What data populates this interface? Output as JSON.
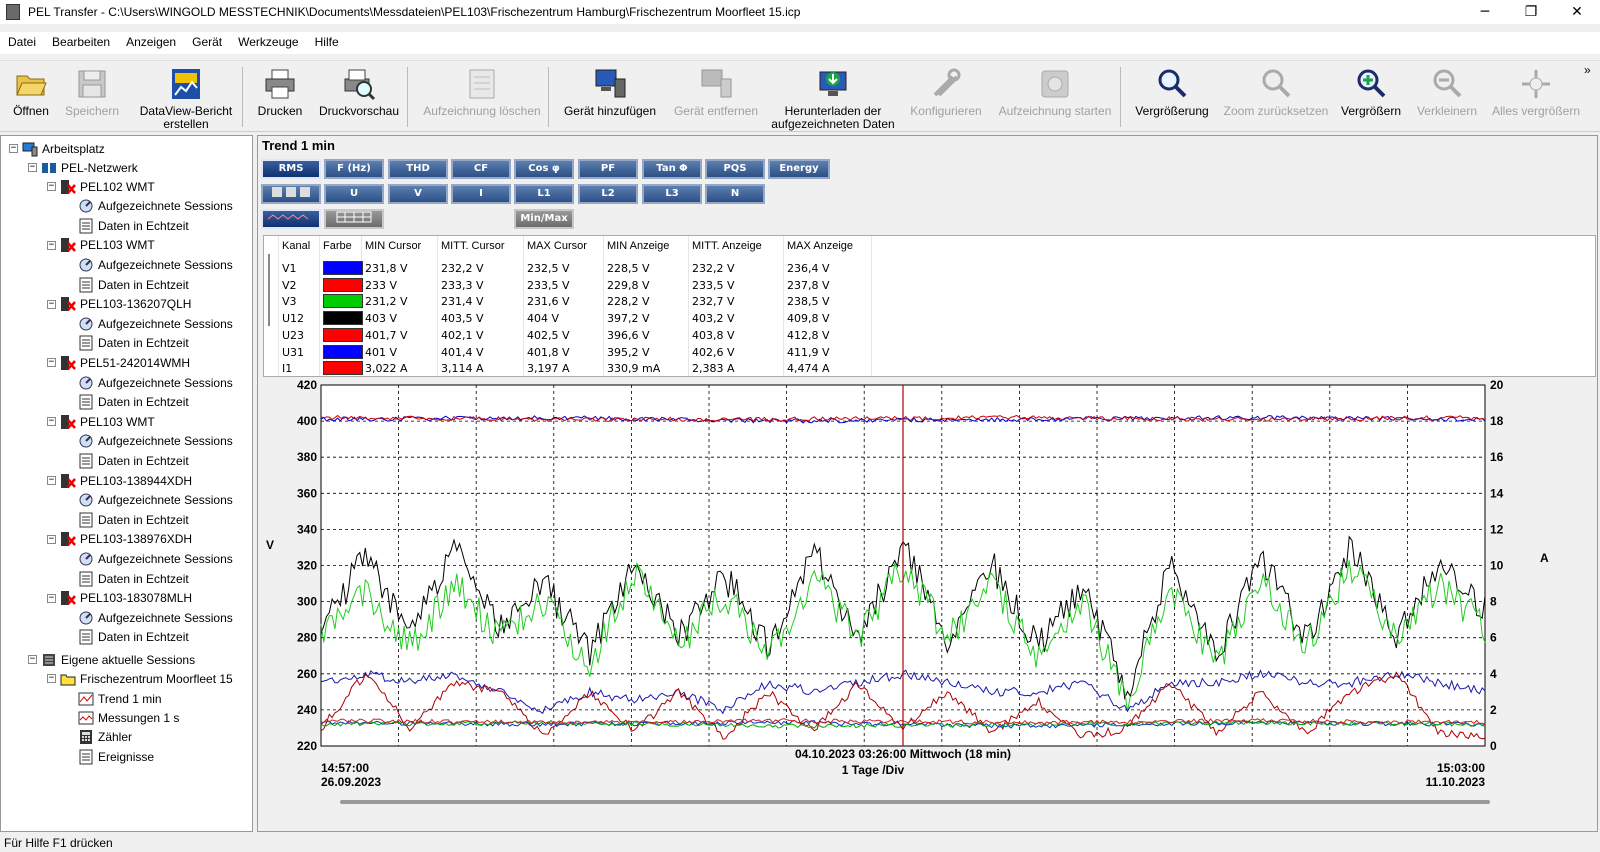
{
  "window": {
    "title": "PEL Transfer - C:\\Users\\WINGOLD MESSTECHNIK\\Documents\\Messdateien\\PEL103\\Frischezentrum Hamburg\\Frischezentrum Moorfleet 15.icp",
    "minimize": "─",
    "maximize": "❐",
    "close": "✕"
  },
  "menu": [
    "Datei",
    "Bearbeiten",
    "Anzeigen",
    "Gerät",
    "Werkzeuge",
    "Hilfe"
  ],
  "toolbar": {
    "open": "Öffnen",
    "save": "Speichern",
    "dataview_l1": "DataView-Bericht",
    "dataview_l2": "erstellen",
    "print": "Drucken",
    "preview": "Druckvorschau",
    "delete_rec": "Aufzeichnung löschen",
    "add_device": "Gerät hinzufügen",
    "remove_device": "Gerät entfernen",
    "download_l1": "Herunterladen der",
    "download_l2": "aufgezeichneten Daten",
    "configure": "Konfigurieren",
    "start_rec": "Aufzeichnung starten",
    "zoom": "Vergrößerung",
    "zoom_reset": "Zoom zurücksetzen",
    "zoom_in": "Vergrößern",
    "zoom_out": "Verkleinern",
    "zoom_all": "Alles vergrößern",
    "overflow": "»"
  },
  "tree": {
    "root": "Arbeitsplatz",
    "network": "PEL-Netzwerk",
    "devices": [
      {
        "name": "PEL102 WMT",
        "sessions": "Aufgezeichnete Sessions",
        "realtime": "Daten in Echtzeit"
      },
      {
        "name": "PEL103 WMT",
        "sessions": "Aufgezeichnete Sessions",
        "realtime": "Daten in Echtzeit"
      },
      {
        "name": "PEL103-136207QLH",
        "sessions": "Aufgezeichnete Sessions",
        "realtime": "Daten in Echtzeit"
      },
      {
        "name": "PEL51-242014WMH",
        "sessions": "Aufgezeichnete Sessions",
        "realtime": "Daten in Echtzeit"
      },
      {
        "name": "PEL103 WMT",
        "sessions": "Aufgezeichnete Sessions",
        "realtime": "Daten in Echtzeit"
      },
      {
        "name": "PEL103-138944XDH",
        "sessions": "Aufgezeichnete Sessions",
        "realtime": "Daten in Echtzeit"
      },
      {
        "name": "PEL103-138976XDH",
        "sessions": "Aufgezeichnete Sessions",
        "realtime": "Daten in Echtzeit"
      },
      {
        "name": "PEL103-183078MLH",
        "sessions": "Aufgezeichnete Sessions",
        "realtime": "Daten in Echtzeit"
      }
    ],
    "own_sessions": "Eigene aktuelle Sessions",
    "session": "Frischezentrum Moorfleet 15",
    "children": [
      "Trend 1 min",
      "Messungen 1 s",
      "Zähler",
      "Ereignisse"
    ]
  },
  "panel": {
    "title": "Trend 1 min",
    "row1": [
      "RMS",
      "F (Hz)",
      "THD",
      "CF",
      "Cos φ",
      "PF",
      "Tan Φ",
      "PQS",
      "Energy"
    ],
    "row2": [
      "U",
      "V",
      "I",
      "L1",
      "L2",
      "L3",
      "N"
    ],
    "minmax": "Min/Max"
  },
  "table": {
    "headers": [
      "Kanal",
      "Farbe",
      "MIN Cursor",
      "MITT. Cursor",
      "MAX Cursor",
      "MIN Anzeige",
      "MITT. Anzeige",
      "MAX Anzeige"
    ],
    "rows": [
      {
        "ch": "V1",
        "color": "#0000ff",
        "v": [
          "231,8 V",
          "232,2 V",
          "232,5 V",
          "228,5 V",
          "232,2 V",
          "236,4 V"
        ]
      },
      {
        "ch": "V2",
        "color": "#ff0000",
        "v": [
          "233 V",
          "233,3 V",
          "233,5 V",
          "229,8 V",
          "233,5 V",
          "237,8 V"
        ]
      },
      {
        "ch": "V3",
        "color": "#00cc00",
        "v": [
          "231,2 V",
          "231,4 V",
          "231,6 V",
          "228,2 V",
          "232,7 V",
          "238,5 V"
        ]
      },
      {
        "ch": "U12",
        "color": "#000000",
        "v": [
          "403 V",
          "403,5 V",
          "404 V",
          "397,2 V",
          "403,2 V",
          "409,8 V"
        ]
      },
      {
        "ch": "U23",
        "color": "#ff0000",
        "v": [
          "401,7 V",
          "402,1 V",
          "402,5 V",
          "396,6 V",
          "403,8 V",
          "412,8 V"
        ]
      },
      {
        "ch": "U31",
        "color": "#0000ff",
        "v": [
          "401 V",
          "401,4 V",
          "401,8 V",
          "395,2 V",
          "402,6 V",
          "411,9 V"
        ]
      },
      {
        "ch": "I1",
        "color": "#ff0000",
        "v": [
          "3,022 A",
          "3,114 A",
          "3,197 A",
          "330,9 mA",
          "2,383 A",
          "4,474 A"
        ]
      }
    ]
  },
  "chart_data": {
    "type": "line",
    "ylabel": "V",
    "y2label": "A",
    "ylim": [
      220,
      420
    ],
    "y2lim": [
      0,
      20
    ],
    "yticks": [
      "420",
      "400",
      "380",
      "360",
      "340",
      "320",
      "300",
      "280",
      "260",
      "240",
      "220"
    ],
    "y2ticks": [
      "20",
      "18",
      "16",
      "14",
      "12",
      "10",
      "8",
      "6",
      "4",
      "2",
      "0"
    ],
    "x_start_time": "14:57:00",
    "x_start_date": "26.09.2023",
    "x_end_time": "15:03:00",
    "x_end_date": "11.10.2023",
    "cursor_label": "04.10.2023 03:26:00 Mittwoch (18 min)",
    "scale_label": "1 Tage /Div",
    "grid": true,
    "series": [
      {
        "color": "#0000cc",
        "axis": "left",
        "values": [
          401,
          402,
          400,
          401,
          402,
          401
        ]
      },
      {
        "color": "#cc0000",
        "axis": "left",
        "values": [
          402,
          401,
          401,
          402,
          401,
          402
        ]
      },
      {
        "color": "#000000",
        "axis": "right",
        "values": [
          6.5,
          10.5,
          6,
          11,
          6.5,
          9,
          5,
          10.5,
          6,
          9.5,
          5.5,
          11,
          6,
          11,
          6,
          10,
          5.5,
          9,
          3,
          10,
          5,
          10.5,
          6,
          11,
          6,
          10,
          7.5
        ]
      },
      {
        "color": "#22cc22",
        "axis": "right",
        "values": [
          6,
          8.5,
          5.5,
          9,
          6,
          8,
          4.5,
          9.5,
          5.5,
          8.5,
          5,
          9.5,
          6,
          10,
          6,
          9,
          5,
          8,
          2.5,
          8.5,
          4.5,
          9.5,
          5.5,
          10,
          6,
          9,
          6.5
        ]
      },
      {
        "color": "#1a1aaa",
        "axis": "right",
        "values": [
          3.5,
          4,
          3.5,
          4,
          3,
          2,
          3,
          2.5,
          3,
          2,
          3.5,
          3,
          3.5,
          4,
          3.5,
          3,
          3,
          3.5,
          2,
          3.5,
          3.5,
          4,
          3.5,
          3.5,
          4,
          3.5,
          3
        ]
      },
      {
        "color": "#aa0000",
        "axis": "right",
        "values": [
          1,
          4,
          1,
          3.5,
          3,
          0.5,
          3,
          0.8,
          3,
          0.5,
          3,
          0.8,
          3.5,
          1,
          3,
          0.7,
          2.5,
          0.5,
          1,
          3.5,
          0.8,
          3,
          0.7,
          3,
          4,
          0.7,
          0.5
        ]
      },
      {
        "color": "#0033cc",
        "axis": "left",
        "values": [
          233,
          232,
          233,
          231,
          233,
          232
        ]
      },
      {
        "color": "#00aa00",
        "axis": "left",
        "values": [
          232,
          233,
          231,
          232,
          233,
          232
        ]
      },
      {
        "color": "#cc2222",
        "axis": "left",
        "values": [
          234,
          233,
          234,
          233,
          234,
          233
        ]
      }
    ]
  },
  "status": "Für Hilfe F1 drücken"
}
